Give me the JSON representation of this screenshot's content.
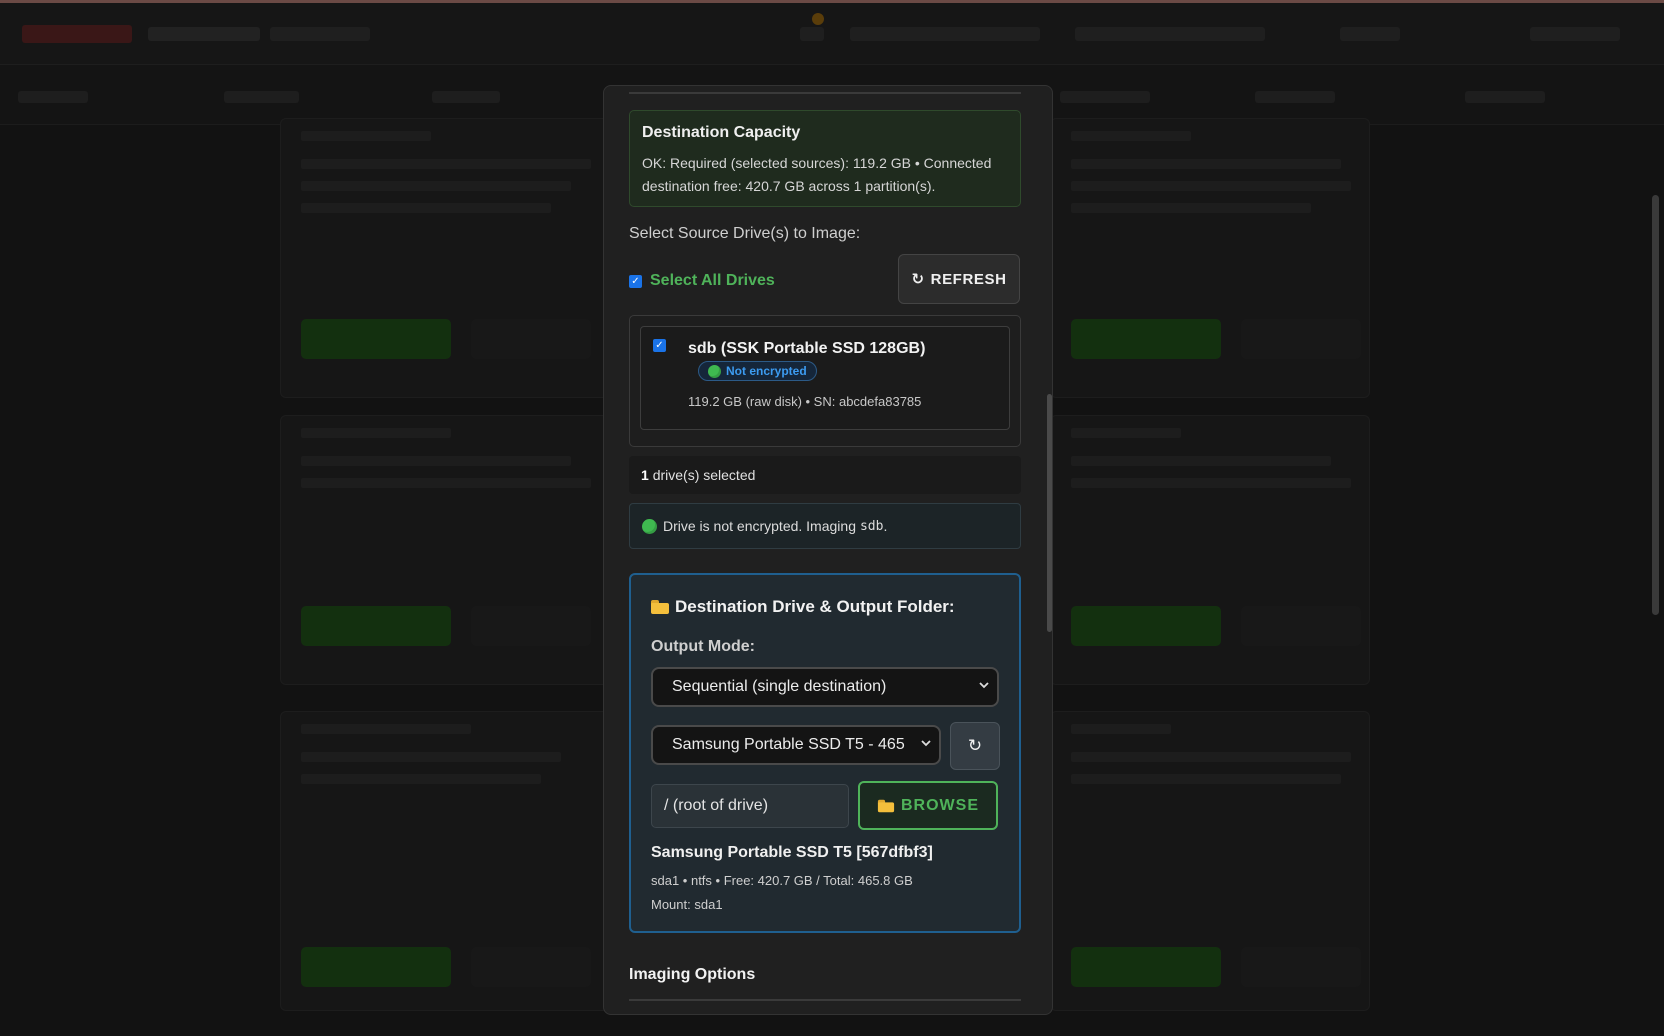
{
  "capacity": {
    "title": "Destination Capacity",
    "text": "OK: Required (selected sources): 119.2 GB • Connected destination free: 420.7 GB across 1 partition(s)."
  },
  "source": {
    "label": "Select Source Drive(s) to Image:",
    "select_all_label": "Select All Drives",
    "select_all_checked": true,
    "refresh_label": "REFRESH",
    "drives": [
      {
        "name": "sdb (SSK Portable SSD 128GB)",
        "checked": true,
        "encryption_badge": "Not encrypted",
        "meta": "119.2 GB (raw disk) • SN: abcdefa83785"
      }
    ],
    "selected_count": "1",
    "selected_suffix": "drive(s) selected",
    "encryption_notice": "Drive is not encrypted. Imaging",
    "encryption_notice_device": "sdb",
    "encryption_notice_end": "."
  },
  "destination": {
    "title": "Destination Drive & Output Folder:",
    "output_mode_label": "Output Mode:",
    "output_mode_value": "Sequential (single destination)",
    "drive_select_value": "Samsung Portable SSD T5 - 465",
    "path_value": "/ (root of drive)",
    "browse_label": "BROWSE",
    "selected_drive_name": "Samsung Portable SSD T5 [567dfbf3]",
    "selected_drive_meta": "sda1 • ntfs • Free: 420.7 GB / Total: 465.8 GB",
    "selected_drive_mount": "Mount: sda1"
  },
  "imaging_options_title": "Imaging Options",
  "colors": {
    "accent_green": "#4fb35a",
    "accent_blue": "#1f5f8f",
    "badge_blue": "#3c9bf0",
    "status_green": "#3fb950"
  },
  "icons": {
    "refresh": "refresh-icon",
    "folder": "folder-icon",
    "status": "green-circle-icon",
    "chevron": "chevron-down-icon"
  }
}
